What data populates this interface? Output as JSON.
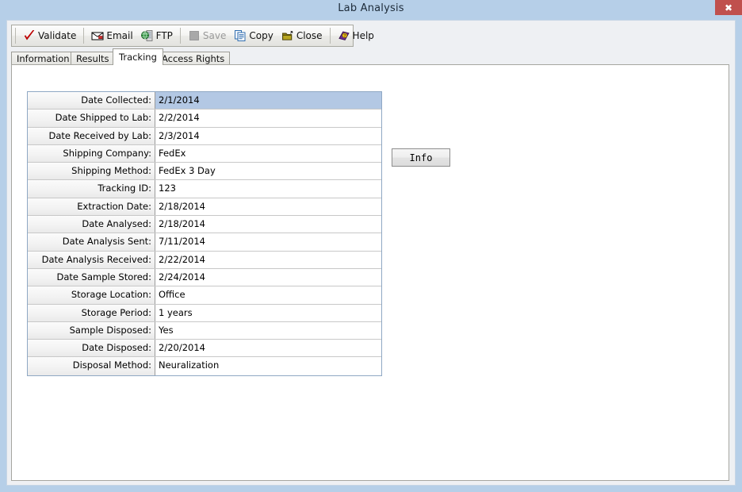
{
  "window": {
    "title": "Lab Analysis",
    "close_label": "✖",
    "close_icon": "close-icon",
    "frame_color": "#b6cfe8",
    "close_button_color": "#c0504d"
  },
  "toolbar": {
    "groups": [
      {
        "buttons": [
          {
            "label": "Validate",
            "icon": "checkmark-icon",
            "enabled": true
          }
        ]
      },
      {
        "buttons": [
          {
            "label": "Email",
            "icon": "envelope-icon",
            "enabled": true
          },
          {
            "label": "FTP",
            "icon": "server-globe-icon",
            "enabled": true
          }
        ]
      },
      {
        "buttons": [
          {
            "label": "Save",
            "icon": "save-icon",
            "enabled": false
          },
          {
            "label": "Copy",
            "icon": "copy-pages-icon",
            "enabled": true
          },
          {
            "label": "Close",
            "icon": "open-folder-icon",
            "enabled": true
          }
        ]
      },
      {
        "buttons": [
          {
            "label": "Help",
            "icon": "help-book-icon",
            "enabled": true
          }
        ]
      }
    ]
  },
  "tabs": [
    {
      "label": "Information",
      "active": false
    },
    {
      "label": "Results",
      "active": false
    },
    {
      "label": "Tracking",
      "active": true
    },
    {
      "label": "Access Rights",
      "active": false
    }
  ],
  "tracking_panel": {
    "selected_row_index": 0,
    "selection_color": "#b3c8e4",
    "rows": [
      {
        "label": "Date Collected:",
        "value": "2/1/2014"
      },
      {
        "label": "Date Shipped to Lab:",
        "value": "2/2/2014"
      },
      {
        "label": "Date Received by Lab:",
        "value": "2/3/2014"
      },
      {
        "label": "Shipping Company:",
        "value": "FedEx"
      },
      {
        "label": "Shipping Method:",
        "value": "FedEx 3 Day"
      },
      {
        "label": "Tracking ID:",
        "value": "123"
      },
      {
        "label": "Extraction Date:",
        "value": "2/18/2014"
      },
      {
        "label": "Date Analysed:",
        "value": "2/18/2014"
      },
      {
        "label": "Date Analysis Sent:",
        "value": "7/11/2014"
      },
      {
        "label": "Date Analysis Received:",
        "value": "2/22/2014"
      },
      {
        "label": "Date Sample Stored:",
        "value": "2/24/2014"
      },
      {
        "label": "Storage Location:",
        "value": "Office"
      },
      {
        "label": "Storage Period:",
        "value": "1 years"
      },
      {
        "label": "Sample Disposed:",
        "value": "Yes"
      },
      {
        "label": "Date Disposed:",
        "value": "2/20/2014"
      },
      {
        "label": "Disposal Method:",
        "value": "Neuralization"
      }
    ],
    "info_button_label": "Info"
  }
}
